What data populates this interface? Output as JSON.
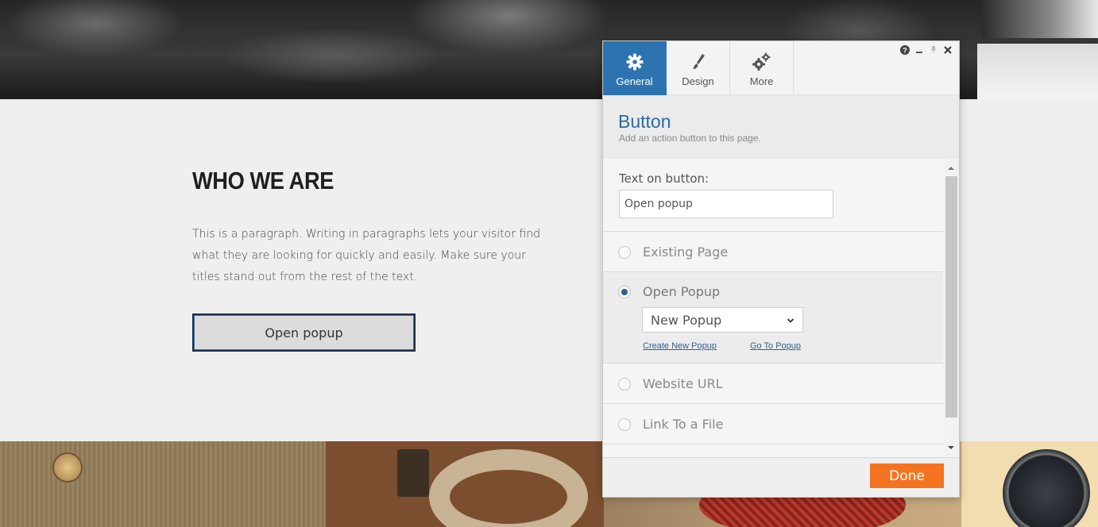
{
  "page": {
    "heading": "WHO WE ARE",
    "paragraph": "This is a paragraph. Writing in paragraphs lets your visitor find what they are looking for quickly and easily. Make sure your titles stand out from the rest of the text.",
    "button_label": "Open popup"
  },
  "panel": {
    "tabs": [
      {
        "label": "General",
        "icon": "gear-icon",
        "active": true
      },
      {
        "label": "Design",
        "icon": "brush-icon",
        "active": false
      },
      {
        "label": "More",
        "icon": "gears-icon",
        "active": false
      }
    ],
    "window_controls": [
      "help-icon",
      "minimize-icon",
      "pin-icon",
      "close-icon"
    ],
    "title": "Button",
    "subtitle": "Add an action button to this page.",
    "text_on_button": {
      "label": "Text on button:",
      "value": "Open popup"
    },
    "link_options": [
      {
        "label": "Existing Page",
        "selected": false
      },
      {
        "label": "Open Popup",
        "selected": true
      },
      {
        "label": "Website URL",
        "selected": false
      },
      {
        "label": "Link To a File",
        "selected": false
      }
    ],
    "popup_select": {
      "value": "New Popup",
      "create_link": "Create New Popup",
      "goto_link": "Go To Popup"
    },
    "done_label": "Done"
  },
  "colors": {
    "accent_blue": "#2d73b0",
    "title_blue": "#2d6aa0",
    "done_orange": "#f47321"
  }
}
